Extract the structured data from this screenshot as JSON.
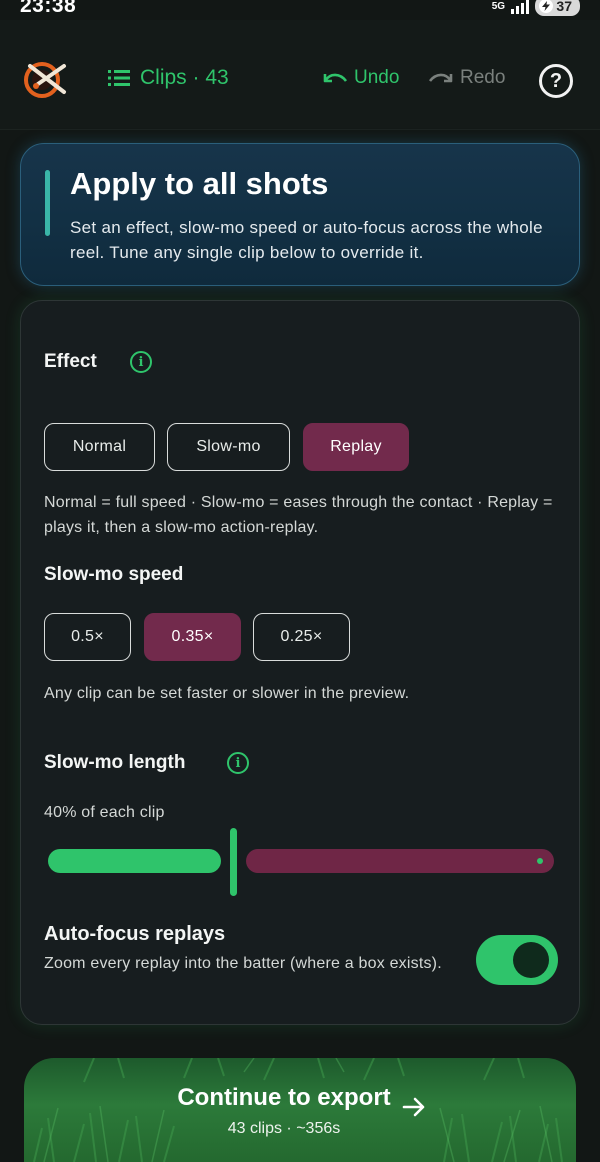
{
  "status_bar": {
    "time": "23:38",
    "network": "5G",
    "battery": "37"
  },
  "header": {
    "clips_label": "Clips · 43",
    "undo_label": "Undo",
    "redo_label": "Redo",
    "help_symbol": "?"
  },
  "hero": {
    "title": "Apply to all shots",
    "subtitle": "Set an effect, slow-mo speed or auto-focus across the whole reel. Tune any single clip below to override it."
  },
  "effect": {
    "title": "Effect",
    "options": [
      "Normal",
      "Slow-mo",
      "Replay"
    ],
    "selected": "Replay",
    "description": "Normal = full speed · Slow-mo = eases through the contact · Replay = plays it, then a slow-mo action-replay."
  },
  "speed": {
    "title": "Slow-mo speed",
    "options": [
      "0.5×",
      "0.35×",
      "0.25×"
    ],
    "selected": "0.35×",
    "description": "Any clip can be set faster or slower in the preview."
  },
  "length": {
    "title": "Slow-mo length",
    "value_label": "40% of each clip",
    "percent": 40
  },
  "autofocus": {
    "title": "Auto-focus replays",
    "description": "Zoom every replay into the batter (where a box exists).",
    "enabled": true
  },
  "cta": {
    "title": "Continue to export",
    "subtitle": "43 clips · ~356s"
  },
  "colors": {
    "accent_green": "#2fc46b",
    "selected_maroon": "#722a4c",
    "hero_blue": "#133246"
  }
}
